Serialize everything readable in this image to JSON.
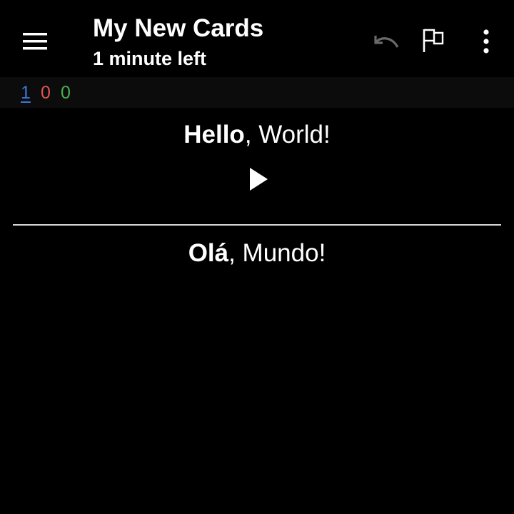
{
  "toolbar": {
    "title": "My New Cards",
    "subtitle": "1 minute left",
    "menu_icon": "hamburger-menu-icon",
    "undo_icon": "undo-icon",
    "flag_icon": "flag-icon",
    "more_icon": "more-vert-icon"
  },
  "counts": {
    "new": "1",
    "learning": "0",
    "review": "0",
    "colors": {
      "new": "#3a78d8",
      "learning": "#e05555",
      "review": "#4caf50"
    }
  },
  "card": {
    "front_bold": "Hello",
    "front_rest": ", World!",
    "play_icon": "play-icon",
    "back_bold": "Olá",
    "back_rest": ", Mundo!"
  },
  "colors": {
    "background": "#000000",
    "counts_bar": "#0c0c0c",
    "text": "#ffffff",
    "disabled_icon": "#6a6a6a",
    "divider": "#d8d8d8"
  }
}
